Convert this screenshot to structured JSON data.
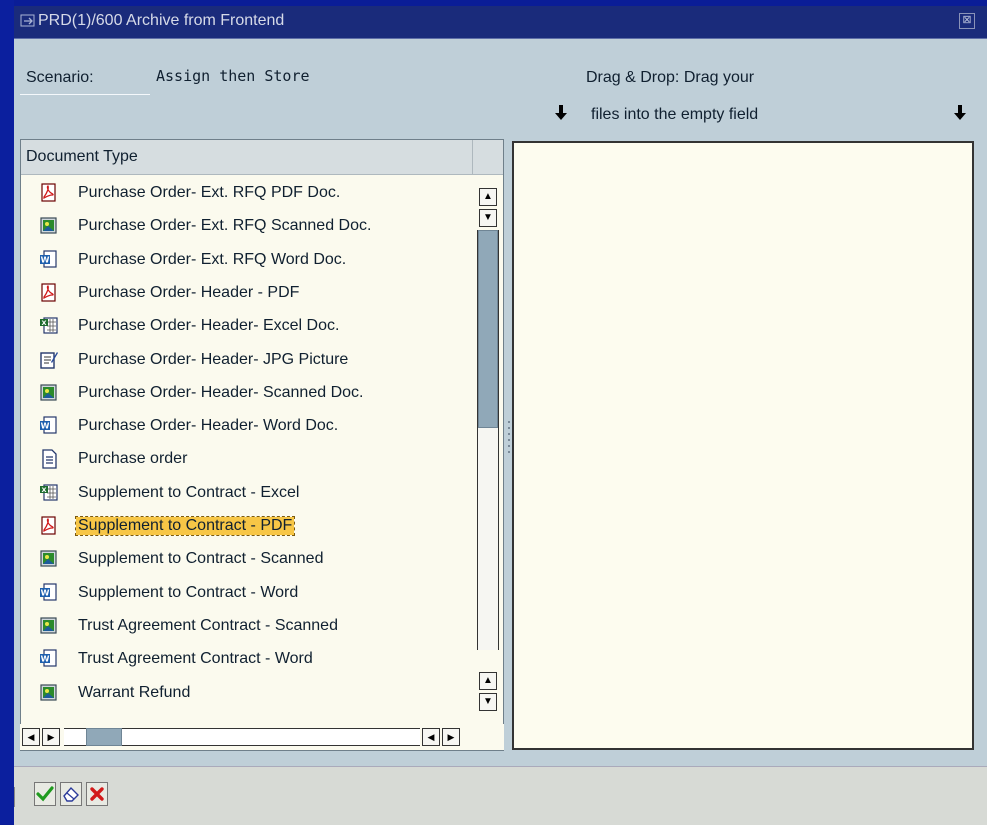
{
  "window": {
    "title": "PRD(1)/600 Archive from Frontend",
    "close_symbol": "⊠"
  },
  "top": {
    "scenario_label": "Scenario:",
    "scenario_value": "Assign then Store",
    "drag_drop_line1": "Drag & Drop: Drag your",
    "drag_drop_line2": "files into the empty field",
    "arrow_symbol": "🠗"
  },
  "list": {
    "header": "Document Type",
    "items": [
      {
        "label": "Purchase Order- Ext. RFQ PDF Doc.",
        "icon": "pdf-icon"
      },
      {
        "label": "Purchase Order- Ext. RFQ Scanned Doc.",
        "icon": "scanned-image-icon"
      },
      {
        "label": "Purchase Order- Ext. RFQ Word Doc.",
        "icon": "word-icon"
      },
      {
        "label": "Purchase Order- Header - PDF",
        "icon": "pdf-icon"
      },
      {
        "label": "Purchase Order- Header- Excel Doc.",
        "icon": "excel-icon"
      },
      {
        "label": "Purchase Order- Header- JPG Picture",
        "icon": "jpg-picture-icon"
      },
      {
        "label": "Purchase Order- Header- Scanned Doc.",
        "icon": "scanned-image-icon"
      },
      {
        "label": "Purchase Order- Header- Word Doc.",
        "icon": "word-icon"
      },
      {
        "label": "Purchase order",
        "icon": "text-document-icon"
      },
      {
        "label": "Supplement to Contract - Excel",
        "icon": "excel-icon"
      },
      {
        "label": "Supplement to Contract - PDF",
        "icon": "pdf-icon",
        "selected": true
      },
      {
        "label": "Supplement to Contract - Scanned",
        "icon": "scanned-image-icon"
      },
      {
        "label": "Supplement to Contract - Word",
        "icon": "word-icon"
      },
      {
        "label": "Trust Agreement Contract - Scanned",
        "icon": "scanned-image-icon"
      },
      {
        "label": "Trust Agreement Contract - Word",
        "icon": "word-icon"
      },
      {
        "label": "Warrant Refund",
        "icon": "scanned-image-icon"
      }
    ]
  },
  "toolbar": {
    "buttons": [
      {
        "name": "confirm-button",
        "icon": "checkmark-icon"
      },
      {
        "name": "clear-button",
        "icon": "eraser-icon"
      },
      {
        "name": "cancel-button",
        "icon": "cancel-x-icon"
      }
    ]
  },
  "colors": {
    "background": "#0a1d97",
    "selected": "#f7c646",
    "panel": "#bfcfd8"
  }
}
